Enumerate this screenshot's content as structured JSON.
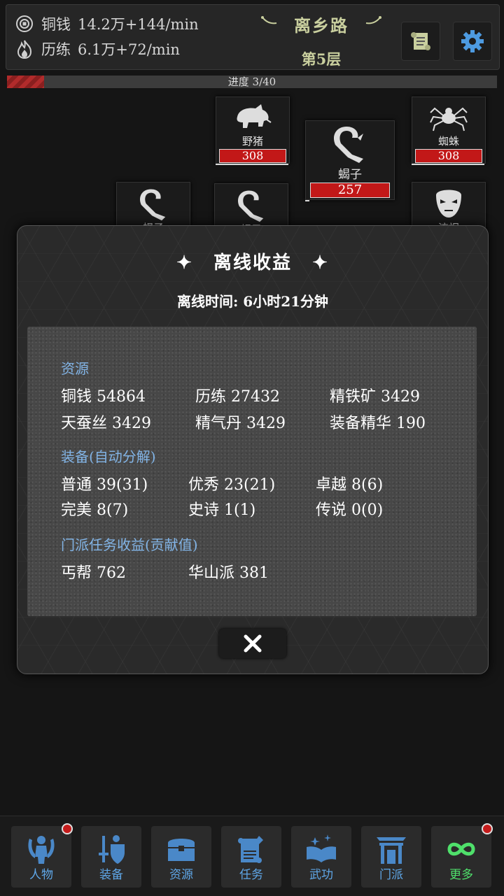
{
  "header": {
    "copper": {
      "label": "铜钱",
      "value": "14.2万+144/min",
      "icon": "coin-icon"
    },
    "training": {
      "label": "历练",
      "value": "6.1万+72/min",
      "icon": "flame-icon"
    },
    "location": "离乡路",
    "floor": "第5层",
    "buttons": [
      {
        "icon": "scroll-icon"
      },
      {
        "icon": "gear-icon"
      }
    ]
  },
  "progress": {
    "text": "进度 3/40",
    "current": 3,
    "total": 40
  },
  "enemies": [
    {
      "name": "野猪",
      "hp": "308",
      "icon": "boar-icon"
    },
    {
      "name": "蜘蛛",
      "hp": "308",
      "icon": "spider-icon"
    },
    {
      "name": "蝎子",
      "hp": "257",
      "icon": "scorpion-icon"
    },
    {
      "name": "蝎子",
      "icon": "scorpion-icon"
    },
    {
      "name": "蝎子",
      "icon": "scorpion-icon"
    },
    {
      "name": "流氓",
      "icon": "mask-icon"
    }
  ],
  "modal": {
    "title": "离线收益",
    "offline_time": "离线时间: 6小时21分钟",
    "sections": {
      "resources": {
        "title": "资源",
        "items": [
          "铜钱  54864",
          "历练  27432",
          "精铁矿  3429",
          "天蚕丝  3429",
          "精气丹  3429",
          "装备精华  190"
        ]
      },
      "equipment": {
        "title": "装备(自动分解)",
        "items": [
          "普通  39(31)",
          "优秀  23(21)",
          "卓越  8(6)",
          "完美  8(7)",
          "史诗  1(1)",
          "传说  0(0)"
        ]
      },
      "sect": {
        "title": "门派任务收益(贡献值)",
        "items": [
          "丐帮  762",
          "华山派  381"
        ]
      }
    },
    "close_icon": "close-icon"
  },
  "nav": [
    {
      "label": "人物",
      "icon": "character-icon",
      "badge": true
    },
    {
      "label": "装备",
      "icon": "sword-shield-icon",
      "badge": false
    },
    {
      "label": "资源",
      "icon": "chest-icon",
      "badge": false
    },
    {
      "label": "任务",
      "icon": "quest-scroll-icon",
      "badge": false
    },
    {
      "label": "武功",
      "icon": "book-icon",
      "badge": false
    },
    {
      "label": "门派",
      "icon": "gate-icon",
      "badge": false
    },
    {
      "label": "更多",
      "icon": "infinity-icon",
      "badge": true
    }
  ],
  "colors": {
    "accent_blue": "#5fa7e8",
    "section_blue": "#82b4e6",
    "hp_red": "#c21818",
    "more_green": "#4fe06b",
    "title_gold": "#c9cf9e"
  }
}
